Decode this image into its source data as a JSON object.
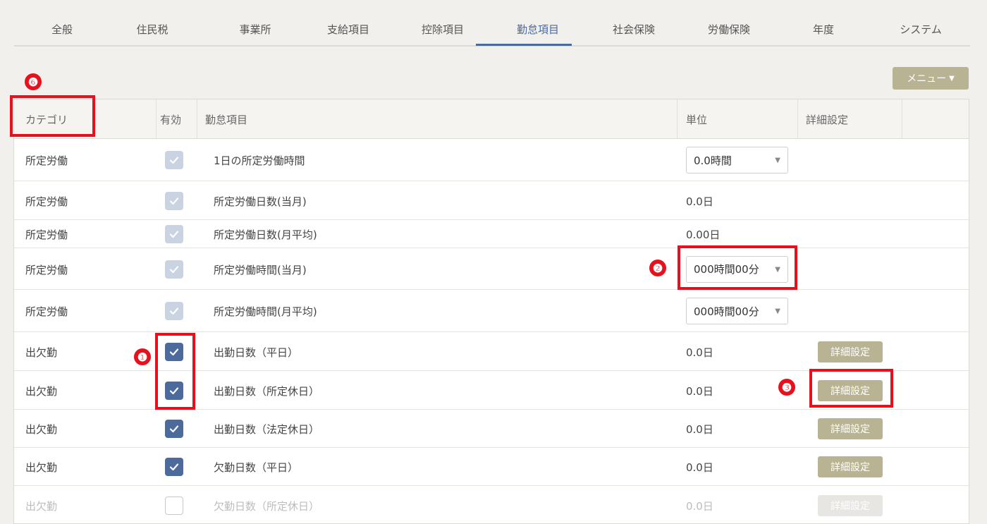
{
  "tabs": [
    "全般",
    "住民税",
    "事業所",
    "支給項目",
    "控除項目",
    "勤怠項目",
    "社会保険",
    "労働保険",
    "年度",
    "システム"
  ],
  "active_tab": "勤怠項目",
  "menu_button": {
    "label": "メニュー"
  },
  "table": {
    "headers": {
      "category": "カテゴリ",
      "enabled": "有効",
      "item": "勤怠項目",
      "unit": "単位",
      "detail": "詳細設定"
    },
    "rows": [
      {
        "category": "所定労働",
        "checkbox": "locked",
        "item": "1日の所定労働時間",
        "unit_type": "select",
        "unit": "0.0時間",
        "detail": ""
      },
      {
        "category": "所定労働",
        "checkbox": "locked",
        "item": "所定労働日数(当月)",
        "unit_type": "text",
        "unit": "0.0日",
        "detail": ""
      },
      {
        "category": "所定労働",
        "checkbox": "locked",
        "item": "所定労働日数(月平均)",
        "unit_type": "text",
        "unit": "0.00日",
        "detail": ""
      },
      {
        "category": "所定労働",
        "checkbox": "locked",
        "item": "所定労働時間(当月)",
        "unit_type": "select",
        "unit": "000時間00分",
        "detail": ""
      },
      {
        "category": "所定労働",
        "checkbox": "locked",
        "item": "所定労働時間(月平均)",
        "unit_type": "select",
        "unit": "000時間00分",
        "detail": ""
      },
      {
        "category": "出欠勤",
        "checkbox": "on",
        "item": "出勤日数（平日）",
        "unit_type": "text",
        "unit": "0.0日",
        "detail": "詳細設定"
      },
      {
        "category": "出欠勤",
        "checkbox": "on",
        "item": "出勤日数（所定休日）",
        "unit_type": "text",
        "unit": "0.0日",
        "detail": "詳細設定"
      },
      {
        "category": "出欠勤",
        "checkbox": "on",
        "item": "出勤日数（法定休日）",
        "unit_type": "text",
        "unit": "0.0日",
        "detail": "詳細設定"
      },
      {
        "category": "出欠勤",
        "checkbox": "on",
        "item": "欠勤日数（平日）",
        "unit_type": "text",
        "unit": "0.0日",
        "detail": "詳細設定"
      },
      {
        "category": "出欠勤",
        "checkbox": "off",
        "item": "欠勤日数（所定休日）",
        "unit_type": "text",
        "unit": "0.0日",
        "detail": "詳細設定",
        "disabled": true
      }
    ]
  },
  "annotations": [
    "❶",
    "❷",
    "❸",
    "❻"
  ],
  "colors": {
    "accent": "#4a6aa0",
    "button": "#b8b393",
    "annotation": "#e8101c",
    "checkbox_on": "#4d6a9c"
  }
}
